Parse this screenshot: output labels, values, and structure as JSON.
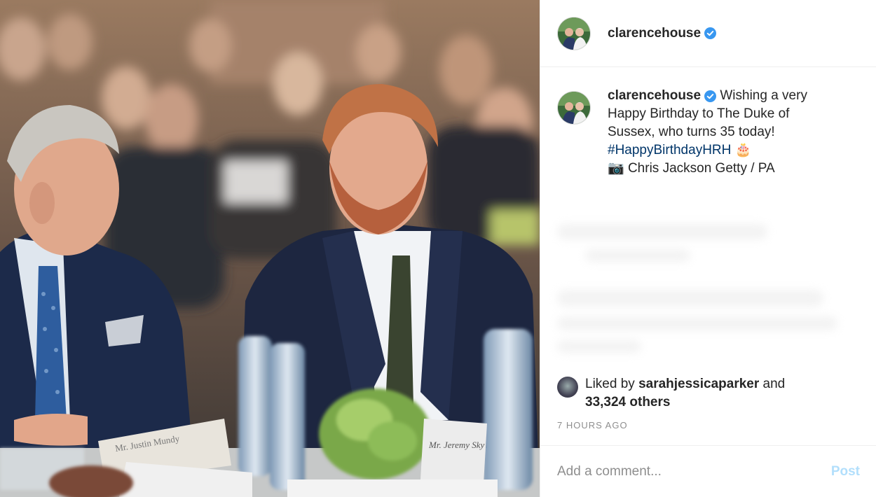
{
  "header": {
    "username": "clarencehouse",
    "verified_icon": "verified-badge-icon",
    "verified_color": "#3897f0"
  },
  "caption": {
    "username": "clarencehouse",
    "text": "Wishing a very Happy Birthday to The Duke of Sussex, who turns 35 today!",
    "hashtag": "#HappyBirthdayHRH",
    "cake_emoji": "🎂",
    "camera_emoji": "📷",
    "credit": "Chris Jackson Getty / PA"
  },
  "likes": {
    "prefix": "Liked by",
    "user": "sarahjessicaparker",
    "conjunction": "and",
    "others": "33,324 others"
  },
  "timestamp": "7 HOURS AGO",
  "comment": {
    "placeholder": "Add a comment...",
    "post_label": "Post",
    "post_color": "#b2dffc"
  },
  "photo": {
    "name_cards": [
      "Mr. Justin Mundy",
      "Mr. Jeremy Sky"
    ]
  }
}
